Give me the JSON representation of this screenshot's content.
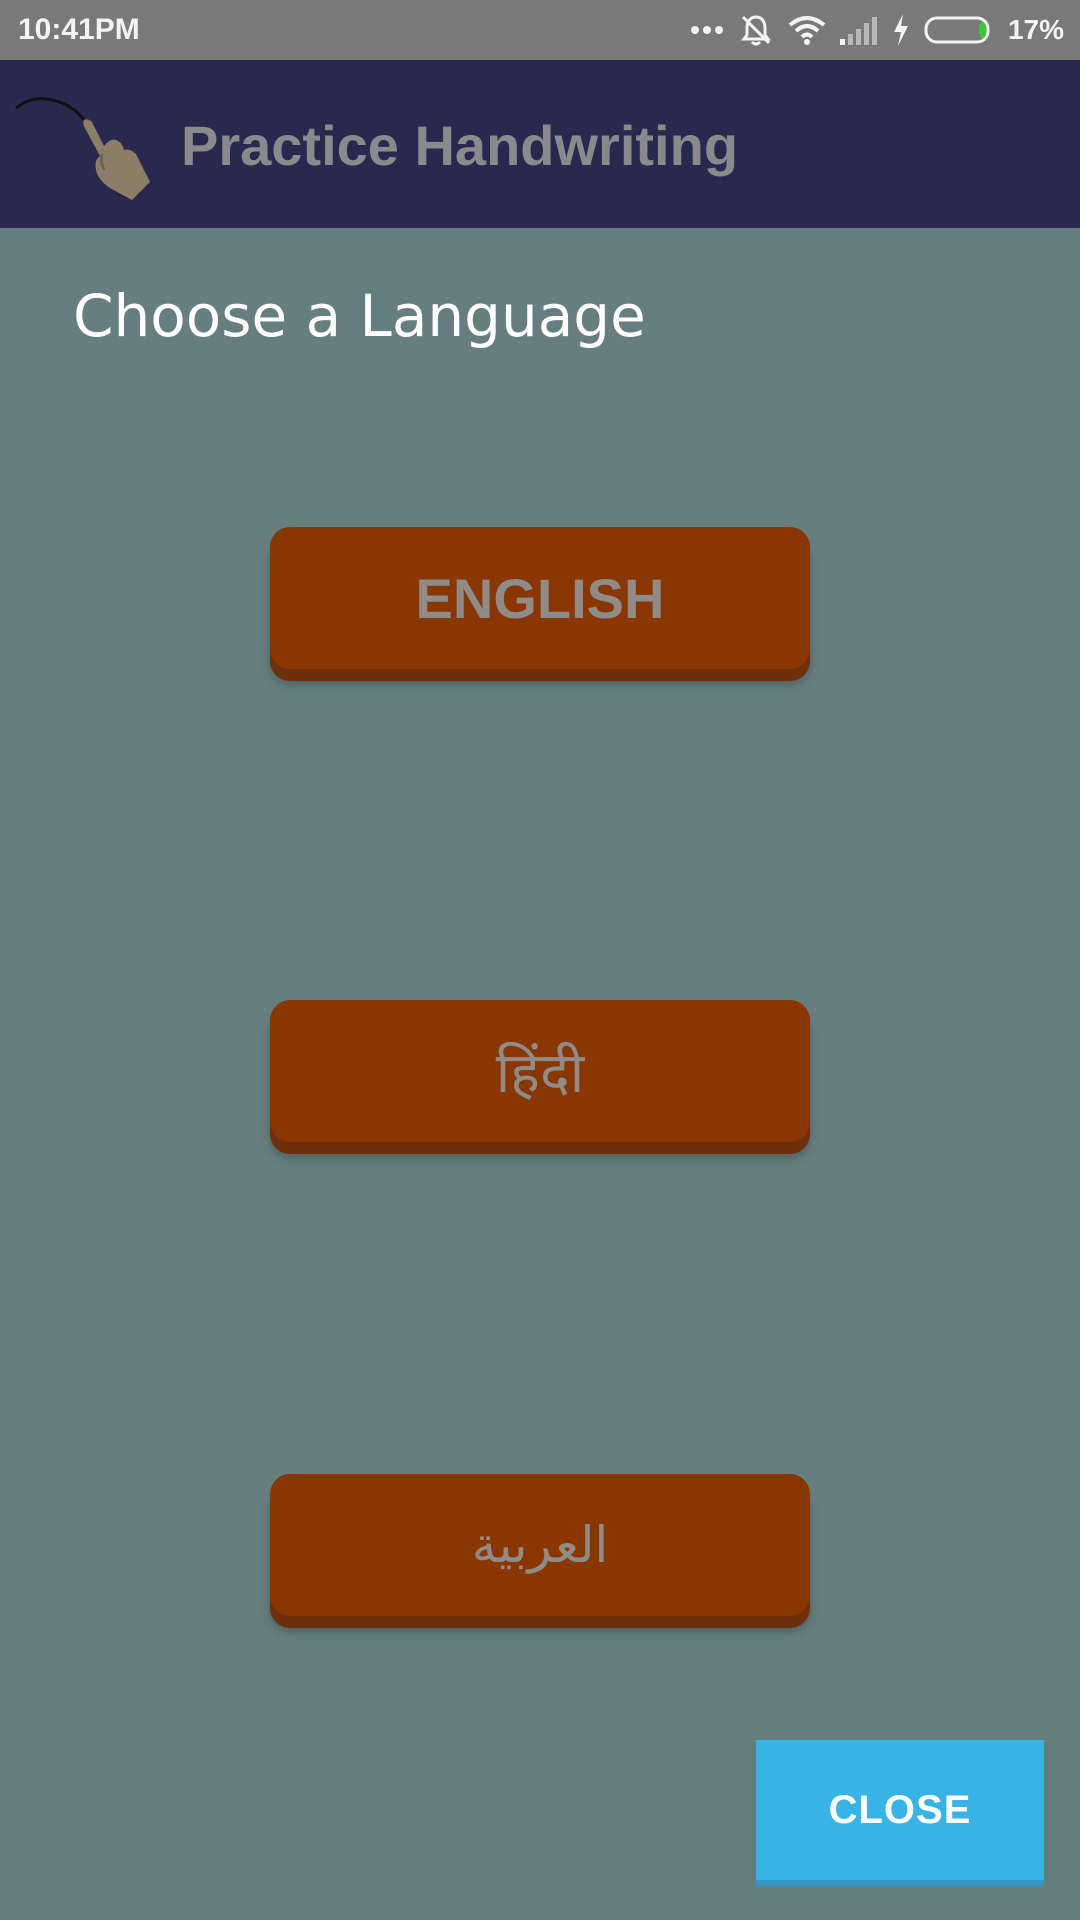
{
  "status_bar": {
    "time": "10:41PM",
    "battery_percent": "17%",
    "icons": [
      "more-dots-icon",
      "mute-vibrate-icon",
      "wifi-icon",
      "signal-icon",
      "charging-bolt-icon",
      "battery-icon"
    ],
    "battery_level": 0.17,
    "battery_fill_color": "#33cc33"
  },
  "app_bar": {
    "title": "Practice Handwriting",
    "logo_icon": "handwriting-finger-icon",
    "background_color": "#29284f"
  },
  "dialog": {
    "title": "Choose a Language",
    "buttons": [
      {
        "label": "ENGLISH"
      },
      {
        "label": "हिंदी"
      },
      {
        "label": "العربية"
      }
    ],
    "button_color": "#8a3600",
    "close_label": "CLOSE",
    "close_color": "#35b4e5"
  }
}
